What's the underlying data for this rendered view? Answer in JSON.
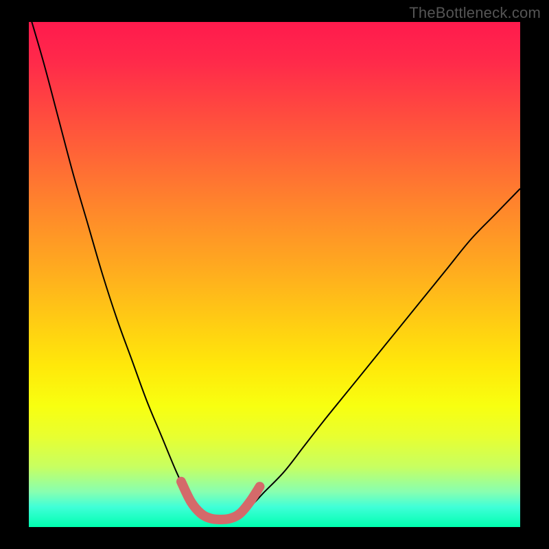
{
  "chart_data": {
    "type": "line",
    "title": "",
    "watermark": "TheBottleneck.com",
    "xlabel": "",
    "ylabel": "",
    "xlim": [
      0,
      100
    ],
    "ylim": [
      0,
      100
    ],
    "grid": false,
    "legend": false,
    "background_gradient": {
      "direction": "top_to_bottom",
      "stops": [
        {
          "pos": 0,
          "color": "#ff1a4d"
        },
        {
          "pos": 50,
          "color": "#ffc815"
        },
        {
          "pos": 75,
          "color": "#f8ff10"
        },
        {
          "pos": 100,
          "color": "#00ffb0"
        }
      ]
    },
    "series": [
      {
        "name": "left_branch",
        "color": "#000000",
        "x": [
          0,
          3,
          6,
          9,
          12,
          15,
          18,
          21,
          24,
          27,
          30,
          32,
          34,
          36
        ],
        "y": [
          102,
          92,
          81,
          70,
          60,
          50,
          41,
          33,
          25,
          18,
          11,
          7,
          4,
          2
        ]
      },
      {
        "name": "right_branch",
        "color": "#000000",
        "x": [
          42,
          45,
          48,
          52,
          56,
          60,
          65,
          70,
          75,
          80,
          85,
          90,
          95,
          100
        ],
        "y": [
          2,
          4,
          7,
          11,
          16,
          21,
          27,
          33,
          39,
          45,
          51,
          57,
          62,
          67
        ]
      },
      {
        "name": "highlight_arc",
        "color": "#d46a6a",
        "x": [
          31,
          33,
          35,
          37,
          39,
          41,
          43,
          45,
          47
        ],
        "y": [
          9,
          5,
          2.7,
          1.7,
          1.5,
          1.7,
          2.7,
          5,
          8
        ]
      }
    ],
    "annotations": []
  }
}
